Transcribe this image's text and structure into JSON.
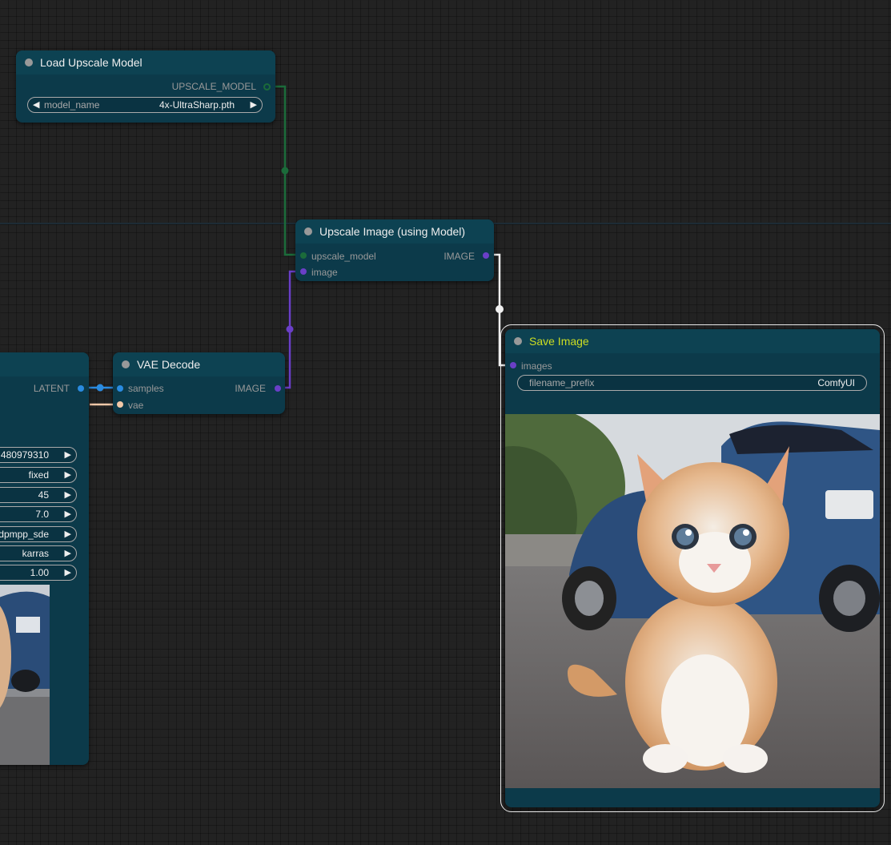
{
  "nodes": {
    "load_upscale": {
      "title": "Load Upscale Model",
      "output": "UPSCALE_MODEL",
      "widget": {
        "label": "model_name",
        "value": "4x-UltraSharp.pth"
      }
    },
    "upscale_image": {
      "title": "Upscale Image (using Model)",
      "inputs": [
        "upscale_model",
        "image"
      ],
      "output": "IMAGE"
    },
    "vae_decode": {
      "title": "VAE Decode",
      "inputs": [
        "samples",
        "vae"
      ],
      "output": "IMAGE"
    },
    "save_image": {
      "title": "Save Image",
      "input": "images",
      "widget": {
        "label": "filename_prefix",
        "value": "ComfyUI"
      }
    },
    "ksampler": {
      "output": "LATENT",
      "widget_values": [
        "480979310",
        "fixed",
        "45",
        "7.0",
        "dpmpp_sde",
        "karras",
        "1.00"
      ]
    }
  },
  "colors": {
    "upscale_model_link": "#1b6b3a",
    "image_link": "#6a3fc7",
    "latent_link": "#2a8be0",
    "vae_link": "#f2c8a8",
    "selected_border": "#e8e8e8",
    "save_title": "#ccdd22"
  }
}
